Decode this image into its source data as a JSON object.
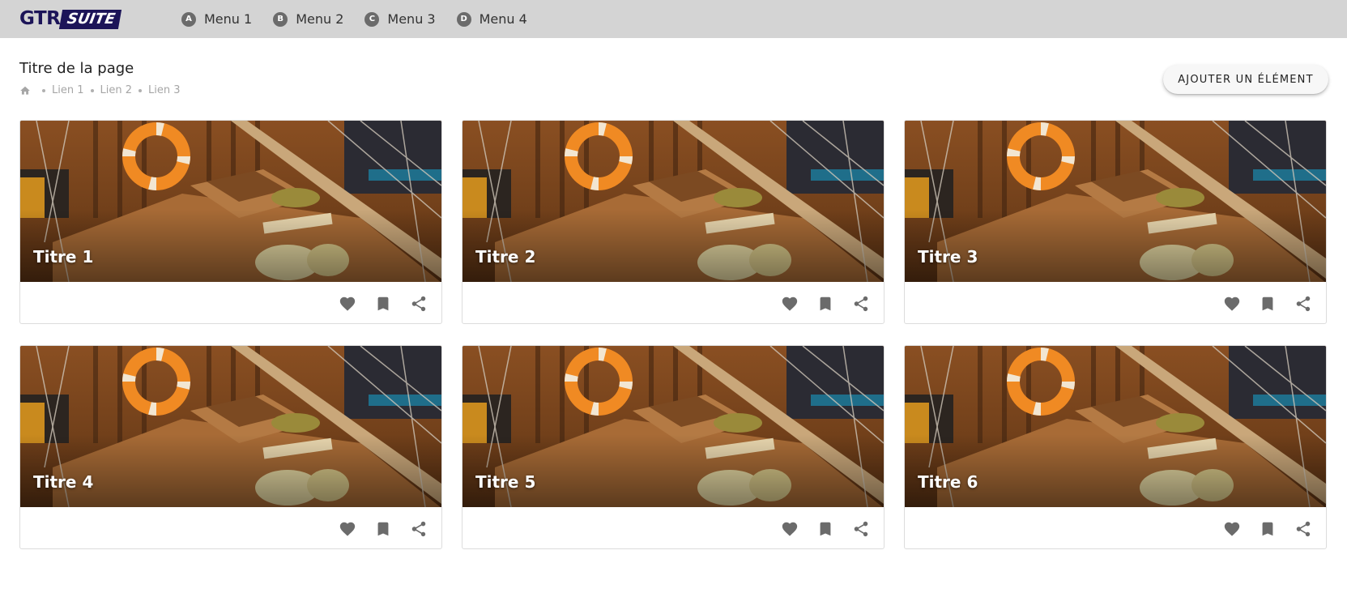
{
  "header": {
    "logo_text_primary": "GTR",
    "logo_text_secondary": "SUITE",
    "logo_color": "#1c1458",
    "menu": [
      {
        "badge": "A",
        "label": "Menu 1"
      },
      {
        "badge": "B",
        "label": "Menu 2"
      },
      {
        "badge": "C",
        "label": "Menu 3"
      },
      {
        "badge": "D",
        "label": "Menu 4"
      }
    ]
  },
  "page": {
    "title": "Titre de la page",
    "breadcrumb": {
      "home_icon": "home-icon",
      "links": [
        "Lien 1",
        "Lien 2",
        "Lien 3"
      ]
    },
    "add_button_label": "AJOUTER UN ÉLÉMENT"
  },
  "cards": [
    {
      "title": "Titre 1"
    },
    {
      "title": "Titre 2"
    },
    {
      "title": "Titre 3"
    },
    {
      "title": "Titre 4"
    },
    {
      "title": "Titre 5"
    },
    {
      "title": "Titre 6"
    }
  ],
  "card_actions": [
    "heart-icon",
    "bookmark-icon",
    "share-icon"
  ],
  "colors": {
    "topbar": "#d4d4d4",
    "icon_gray": "#6b6b6b"
  }
}
